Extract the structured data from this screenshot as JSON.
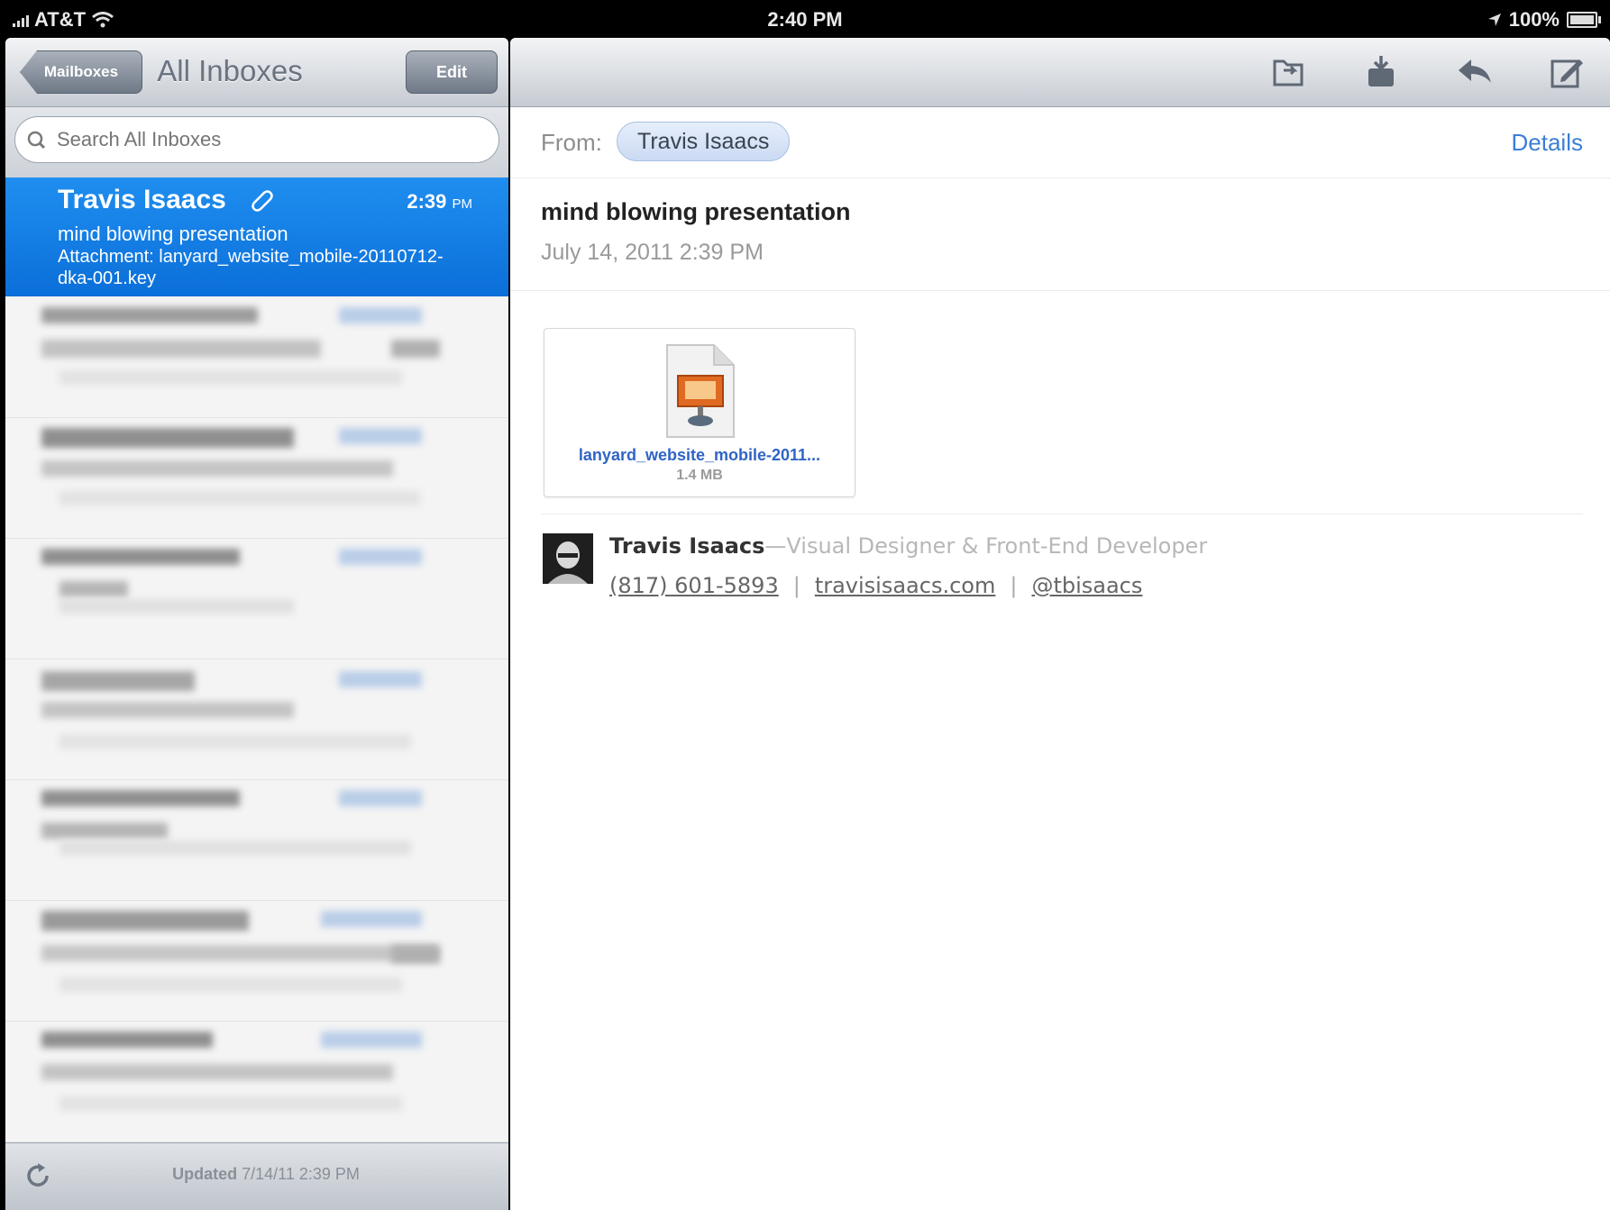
{
  "status_bar": {
    "carrier": "AT&T",
    "time": "2:40 PM",
    "battery": "100%",
    "battery_level": 1.0
  },
  "left_pane": {
    "back_label": "Mailboxes",
    "title": "All Inboxes",
    "edit_label": "Edit",
    "search_placeholder": "Search All Inboxes",
    "selected_message": {
      "sender": "Travis Isaacs",
      "time": "2:39",
      "time_suffix": "PM",
      "subject": "mind blowing presentation",
      "preview": "Attachment: lanyard_website_mobile-20110712-dka-001.key"
    },
    "footer": {
      "updated_label": "Updated",
      "updated_value": "7/14/11  2:39 PM"
    }
  },
  "message": {
    "from_label": "From:",
    "from_name": "Travis Isaacs",
    "details_label": "Details",
    "subject": "mind blowing presentation",
    "date": "July 14, 2011 2:39 PM",
    "attachment": {
      "name": "lanyard_website_mobile-2011...",
      "size": "1.4 MB"
    },
    "signature": {
      "name": "Travis Isaacs",
      "dash": "—",
      "title": "Visual Designer & Front-End Developer",
      "phone": "(817) 601-5893",
      "website": "travisisaacs.com",
      "twitter": "@tbisaacs",
      "separator": "|"
    }
  },
  "colors": {
    "selection_blue": "#0b6fd9",
    "link_blue": "#3b7ed6",
    "toolbar_gray": "#c6cbd2"
  }
}
